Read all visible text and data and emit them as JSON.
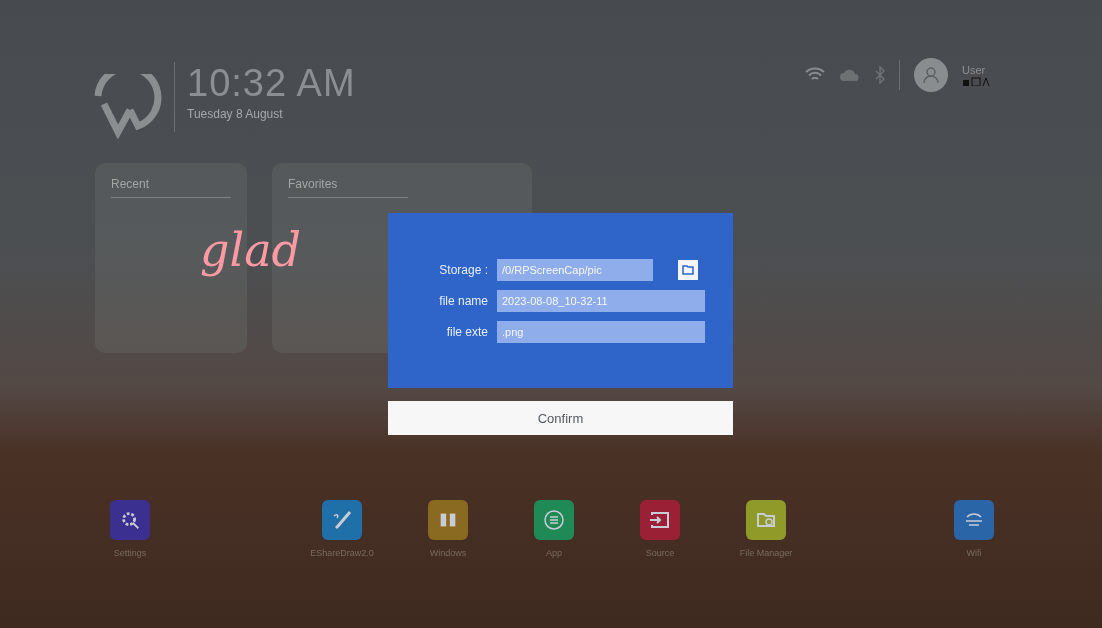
{
  "clock": {
    "time": "10:32 AM",
    "date": "Tuesday 8 August"
  },
  "status": {
    "user": "User"
  },
  "panels": [
    {
      "title": "Recent"
    },
    {
      "title": "Favorites"
    }
  ],
  "ink": {
    "text": "glad"
  },
  "dialog": {
    "fields": [
      {
        "label": "Storage :",
        "value": "/0/RPScreenCap/pic",
        "kind": "browse"
      },
      {
        "label": "file name",
        "value": "2023-08-08_10-32-11",
        "kind": "text"
      },
      {
        "label": "file exte",
        "value": ".png",
        "kind": "text"
      }
    ],
    "confirm": "Confirm"
  },
  "dock": [
    {
      "label": "Settings",
      "kind": "gear",
      "color": "#3b2f8f"
    },
    {
      "label": "EShareDraw2.0",
      "kind": "pen",
      "color": "#1f6fa8"
    },
    {
      "label": "Windows",
      "kind": "split",
      "color": "#8a6a20"
    },
    {
      "label": "App",
      "kind": "app",
      "color": "#1f8a55"
    },
    {
      "label": "Source",
      "kind": "input",
      "color": "#9a2035"
    },
    {
      "label": "File Manager",
      "kind": "file",
      "color": "#8f9a28"
    },
    {
      "label": "Wifi",
      "kind": "wifi",
      "color": "#2a65a8"
    }
  ]
}
